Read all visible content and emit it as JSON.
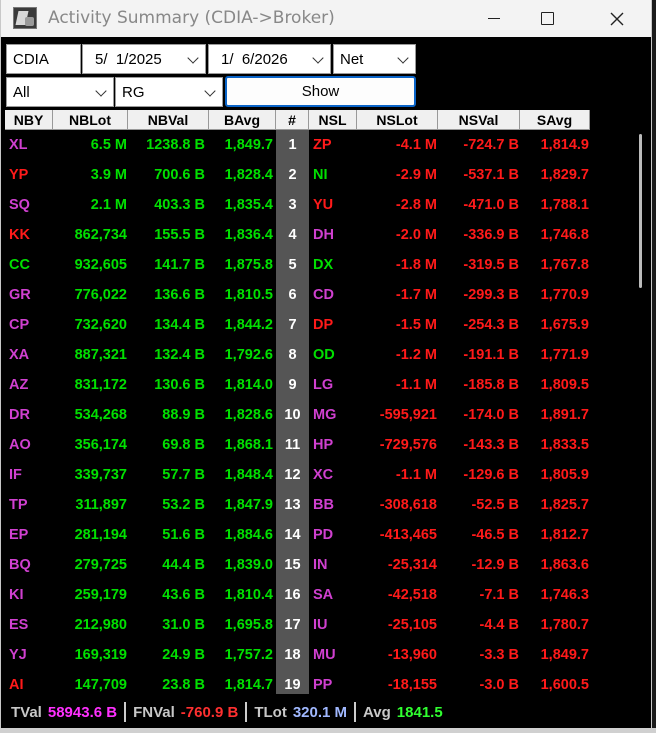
{
  "window": {
    "title": "Activity Summary (CDIA->Broker)"
  },
  "controls": {
    "stock": "CDIA",
    "date_from": "5/  1/2025",
    "date_to": "1/  6/2026",
    "mode": "Net",
    "filter": "All",
    "board": "RG",
    "show_label": "Show"
  },
  "columns": [
    "NBY",
    "NBLot",
    "NBVal",
    "BAvg",
    "#",
    "NSL",
    "NSLot",
    "NSVal",
    "SAvg"
  ],
  "rows": [
    {
      "nby": "XL",
      "nblot": "6.5 M",
      "nbval": "1238.8 B",
      "bavg": "1,849.7",
      "num": "1",
      "nsl": "ZP",
      "nslot": "-4.1 M",
      "nsval": "-724.7 B",
      "savg": "1,814.9",
      "nby_c": "#d040d0",
      "nsl_c": "#ff1a1a"
    },
    {
      "nby": "YP",
      "nblot": "3.9 M",
      "nbval": "700.6 B",
      "bavg": "1,828.4",
      "num": "2",
      "nsl": "NI",
      "nslot": "-2.9 M",
      "nsval": "-537.1 B",
      "savg": "1,829.7",
      "nby_c": "#ff1a1a",
      "nsl_c": "#00e000"
    },
    {
      "nby": "SQ",
      "nblot": "2.1 M",
      "nbval": "403.3 B",
      "bavg": "1,835.4",
      "num": "3",
      "nsl": "YU",
      "nslot": "-2.8 M",
      "nsval": "-471.0 B",
      "savg": "1,788.1",
      "nby_c": "#d040d0",
      "nsl_c": "#ff1a1a"
    },
    {
      "nby": "KK",
      "nblot": "862,734",
      "nbval": "155.5 B",
      "bavg": "1,836.4",
      "num": "4",
      "nsl": "DH",
      "nslot": "-2.0 M",
      "nsval": "-336.9 B",
      "savg": "1,746.8",
      "nby_c": "#ff1a1a",
      "nsl_c": "#d040d0"
    },
    {
      "nby": "CC",
      "nblot": "932,605",
      "nbval": "141.7 B",
      "bavg": "1,875.8",
      "num": "5",
      "nsl": "DX",
      "nslot": "-1.8 M",
      "nsval": "-319.5 B",
      "savg": "1,767.8",
      "nby_c": "#00e000",
      "nsl_c": "#00e000"
    },
    {
      "nby": "GR",
      "nblot": "776,022",
      "nbval": "136.6 B",
      "bavg": "1,810.5",
      "num": "6",
      "nsl": "CD",
      "nslot": "-1.7 M",
      "nsval": "-299.3 B",
      "savg": "1,770.9",
      "nby_c": "#d040d0",
      "nsl_c": "#d040d0"
    },
    {
      "nby": "CP",
      "nblot": "732,620",
      "nbval": "134.4 B",
      "bavg": "1,844.2",
      "num": "7",
      "nsl": "DP",
      "nslot": "-1.5 M",
      "nsval": "-254.3 B",
      "savg": "1,675.9",
      "nby_c": "#d040d0",
      "nsl_c": "#ff1a1a"
    },
    {
      "nby": "XA",
      "nblot": "887,321",
      "nbval": "132.4 B",
      "bavg": "1,792.6",
      "num": "8",
      "nsl": "OD",
      "nslot": "-1.2 M",
      "nsval": "-191.1 B",
      "savg": "1,771.9",
      "nby_c": "#d040d0",
      "nsl_c": "#00e000"
    },
    {
      "nby": "AZ",
      "nblot": "831,172",
      "nbval": "130.6 B",
      "bavg": "1,814.0",
      "num": "9",
      "nsl": "LG",
      "nslot": "-1.1 M",
      "nsval": "-185.8 B",
      "savg": "1,809.5",
      "nby_c": "#d040d0",
      "nsl_c": "#d040d0"
    },
    {
      "nby": "DR",
      "nblot": "534,268",
      "nbval": "88.9 B",
      "bavg": "1,828.6",
      "num": "10",
      "nsl": "MG",
      "nslot": "-595,921",
      "nsval": "-174.0 B",
      "savg": "1,891.7",
      "nby_c": "#d040d0",
      "nsl_c": "#d040d0"
    },
    {
      "nby": "AO",
      "nblot": "356,174",
      "nbval": "69.8 B",
      "bavg": "1,868.1",
      "num": "11",
      "nsl": "HP",
      "nslot": "-729,576",
      "nsval": "-143.3 B",
      "savg": "1,833.5",
      "nby_c": "#d040d0",
      "nsl_c": "#d040d0"
    },
    {
      "nby": "IF",
      "nblot": "339,737",
      "nbval": "57.7 B",
      "bavg": "1,848.4",
      "num": "12",
      "nsl": "XC",
      "nslot": "-1.1 M",
      "nsval": "-129.6 B",
      "savg": "1,805.9",
      "nby_c": "#d040d0",
      "nsl_c": "#d040d0"
    },
    {
      "nby": "TP",
      "nblot": "311,897",
      "nbval": "53.2 B",
      "bavg": "1,847.9",
      "num": "13",
      "nsl": "BB",
      "nslot": "-308,618",
      "nsval": "-52.5 B",
      "savg": "1,825.7",
      "nby_c": "#d040d0",
      "nsl_c": "#d040d0"
    },
    {
      "nby": "EP",
      "nblot": "281,194",
      "nbval": "51.6 B",
      "bavg": "1,884.6",
      "num": "14",
      "nsl": "PD",
      "nslot": "-413,465",
      "nsval": "-46.5 B",
      "savg": "1,812.7",
      "nby_c": "#d040d0",
      "nsl_c": "#d040d0"
    },
    {
      "nby": "BQ",
      "nblot": "279,725",
      "nbval": "44.4 B",
      "bavg": "1,839.0",
      "num": "15",
      "nsl": "IN",
      "nslot": "-25,314",
      "nsval": "-12.9 B",
      "savg": "1,863.6",
      "nby_c": "#d040d0",
      "nsl_c": "#d040d0"
    },
    {
      "nby": "KI",
      "nblot": "259,179",
      "nbval": "43.6 B",
      "bavg": "1,810.4",
      "num": "16",
      "nsl": "SA",
      "nslot": "-42,518",
      "nsval": "-7.1 B",
      "savg": "1,746.3",
      "nby_c": "#d040d0",
      "nsl_c": "#d040d0"
    },
    {
      "nby": "ES",
      "nblot": "212,980",
      "nbval": "31.0 B",
      "bavg": "1,695.8",
      "num": "17",
      "nsl": "IU",
      "nslot": "-25,105",
      "nsval": "-4.4 B",
      "savg": "1,780.7",
      "nby_c": "#d040d0",
      "nsl_c": "#d040d0"
    },
    {
      "nby": "YJ",
      "nblot": "169,319",
      "nbval": "24.9 B",
      "bavg": "1,757.2",
      "num": "18",
      "nsl": "MU",
      "nslot": "-13,960",
      "nsval": "-3.3 B",
      "savg": "1,849.7",
      "nby_c": "#d040d0",
      "nsl_c": "#d040d0"
    },
    {
      "nby": "AI",
      "nblot": "147,709",
      "nbval": "23.8 B",
      "bavg": "1,814.7",
      "num": "19",
      "nsl": "PP",
      "nslot": "-18,155",
      "nsval": "-3.0 B",
      "savg": "1,600.5",
      "nby_c": "#ff1a1a",
      "nsl_c": "#d040d0"
    }
  ],
  "footer": {
    "tval_label": "TVal",
    "tval": "58943.6 B",
    "fnval_label": "FNVal",
    "fnval": "-760.9 B",
    "tlot_label": "TLot",
    "tlot": "320.1 M",
    "avg_label": "Avg",
    "avg": "1841.5"
  }
}
